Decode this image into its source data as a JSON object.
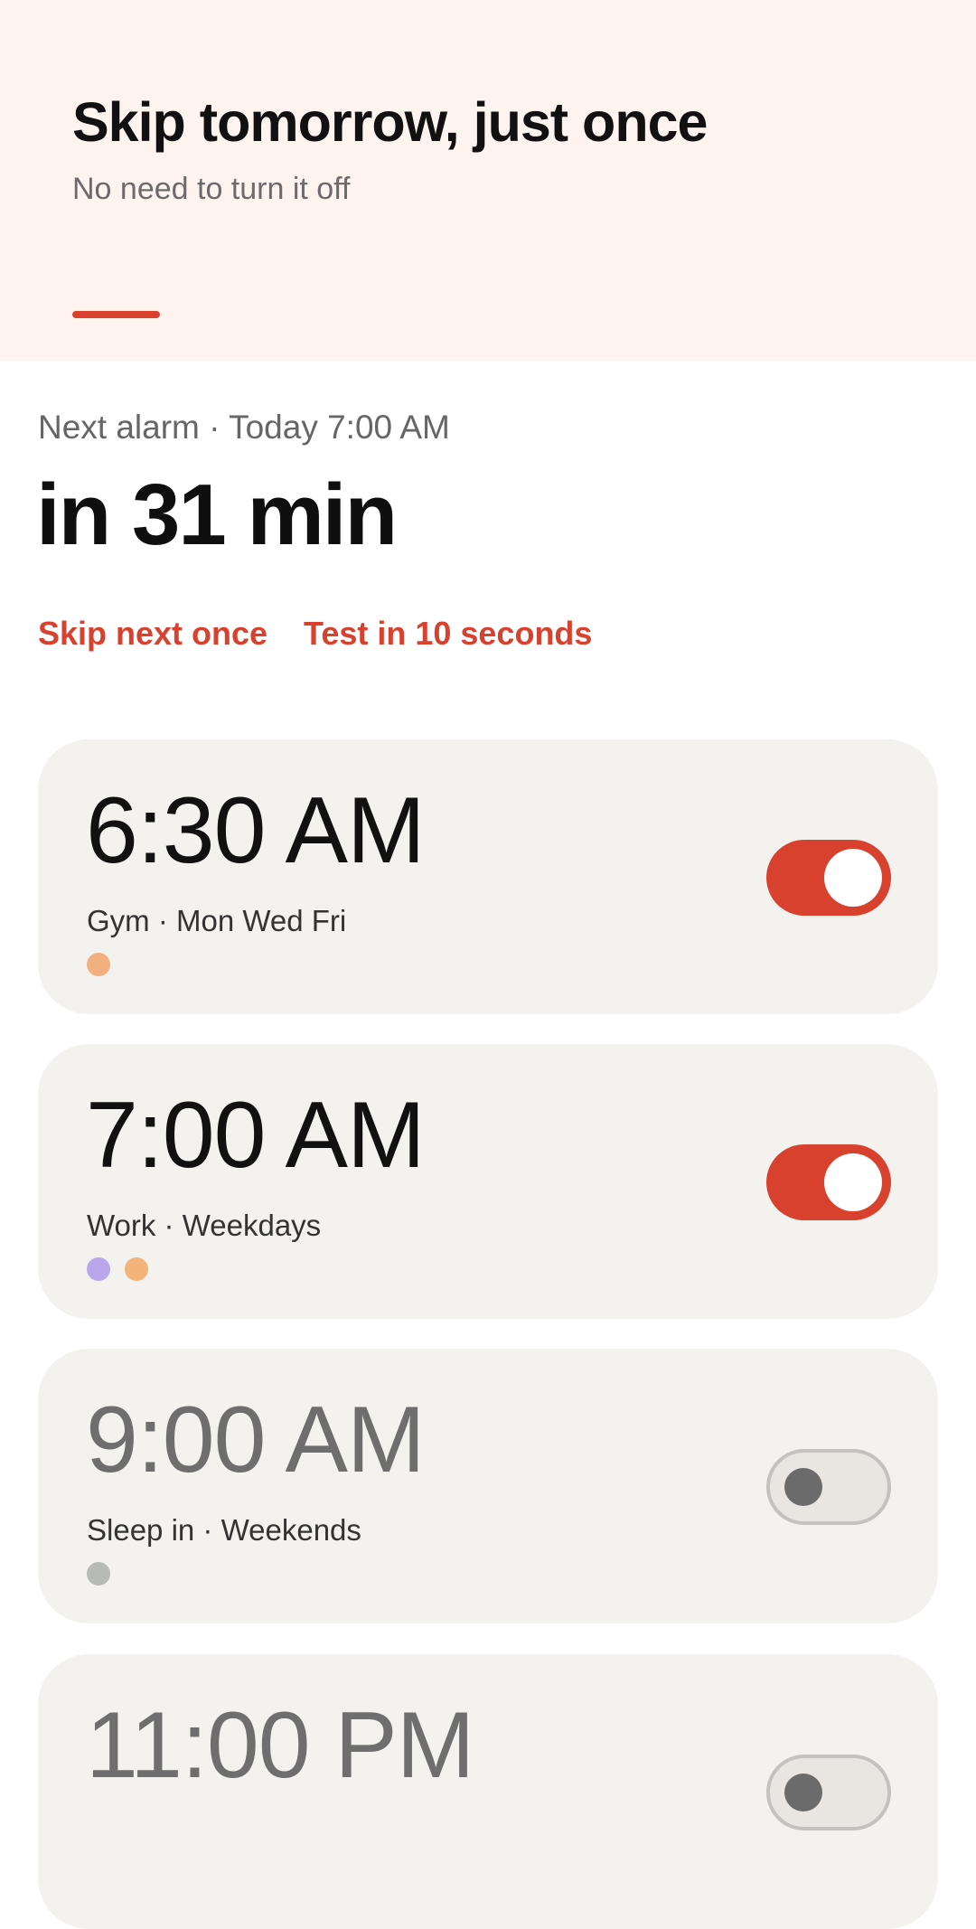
{
  "banner": {
    "title": "Skip tomorrow, just once",
    "subtitle": "No need to turn it off",
    "accent": "#d9412f"
  },
  "next_alarm": {
    "label": "Next alarm · Today 7:00 AM",
    "countdown": "in 31 min"
  },
  "actions": {
    "skip_label": "Skip next once",
    "test_label": "Test in 10 seconds"
  },
  "alarms": [
    {
      "time": "6:30 AM",
      "meta": "Gym · Mon Wed Fri",
      "enabled": true,
      "dots": [
        "#f2b07f"
      ]
    },
    {
      "time": "7:00 AM",
      "meta": "Work · Weekdays",
      "enabled": true,
      "dots": [
        "#b9a6ec",
        "#f2b478"
      ]
    },
    {
      "time": "9:00 AM",
      "meta": "Sleep in · Weekends",
      "enabled": false,
      "dots": [
        "#b7bab7"
      ]
    },
    {
      "time": "11:00 PM",
      "meta": "",
      "enabled": false,
      "dots": []
    }
  ]
}
